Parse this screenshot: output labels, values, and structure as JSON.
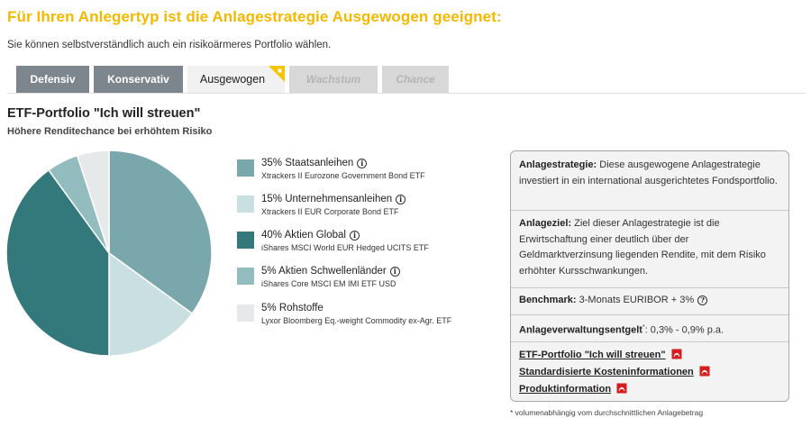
{
  "header": {
    "title": "Für Ihren Anlegertyp ist die Anlagestrategie Ausgewogen geeignet:",
    "subtitle": "Sie können selbstverständlich auch ein risikoärmeres Portfolio wählen."
  },
  "tabs": [
    {
      "label": "Defensiv",
      "state": "filled"
    },
    {
      "label": "Konservativ",
      "state": "filled"
    },
    {
      "label": "Ausgewogen",
      "state": "active"
    },
    {
      "label": "Wachstum",
      "state": "disabled"
    },
    {
      "label": "Chance",
      "state": "disabled"
    }
  ],
  "portfolio": {
    "title": "ETF-Portfolio \"Ich will streuen\"",
    "subtitle": "Höhere Renditechance bei erhöhtem Risiko"
  },
  "colors": {
    "accent": "#f5b800",
    "staatsanleihen": "#7aa7ab",
    "unternehmensanleihen": "#c9dfe1",
    "aktien_global": "#33787a",
    "schwellenlaender": "#93bcbf",
    "rohstoffe": "#e6e9ea"
  },
  "chart_data": {
    "type": "pie",
    "slices": [
      {
        "label": "35% Staatsanleihen",
        "value": 35,
        "color": "#7aa7ab"
      },
      {
        "label": "15% Unternehmensanleihen",
        "value": 15,
        "color": "#c9dfe1"
      },
      {
        "label": "40% Aktien Global",
        "value": 40,
        "color": "#33787a"
      },
      {
        "label": "5% Aktien Schwellenländer",
        "value": 5,
        "color": "#93bcbf"
      },
      {
        "label": "5% Rohstoffe",
        "value": 5,
        "color": "#e6e9ea"
      }
    ]
  },
  "legend": [
    {
      "title": "35% Staatsanleihen",
      "sub": "Xtrackers II Eurozone Government Bond ETF",
      "info": true
    },
    {
      "title": "15% Unternehmensanleihen",
      "sub": "Xtrackers II EUR Corporate Bond ETF",
      "info": true
    },
    {
      "title": "40% Aktien Global",
      "sub": "iShares MSCI World EUR Hedged UCITS ETF",
      "info": true
    },
    {
      "title": "5% Aktien Schwellenländer",
      "sub": "iShares Core MSCI EM IMI ETF USD",
      "info": true
    },
    {
      "title": "5% Rohstoffe",
      "sub": "Lyxor Bloomberg Eq.-weight Commodity ex-Agr. ETF",
      "info": true
    }
  ],
  "infobox": {
    "strategy_label": "Anlagestrategie:",
    "strategy_text": "Diese ausgewogene Anlagestrategie investiert in ein international ausgerichtetes Fondsportfolio.",
    "goal_label": "Anlageziel:",
    "goal_text": "Ziel dieser Anlagestrategie ist die Erwirtschaftung einer deutlich über der Geldmarktverzinsung liegenden Rendite, mit dem Risiko erhöhter Kursschwankungen.",
    "benchmark_label": "Benchmark:",
    "benchmark_text": "3-Monats EURIBOR + 3%",
    "fee_label": "Anlageverwaltungsentgelt",
    "fee_mark": "*",
    "fee_text": ": 0,3% - 0,9% p.a.",
    "links": [
      "ETF-Portfolio \"Ich will streuen\"",
      "Standardisierte Kosteninformationen",
      "Produktinformation"
    ]
  },
  "footnote": "* volumenabhängig vom durchschnittlichen Anlagebetrag"
}
